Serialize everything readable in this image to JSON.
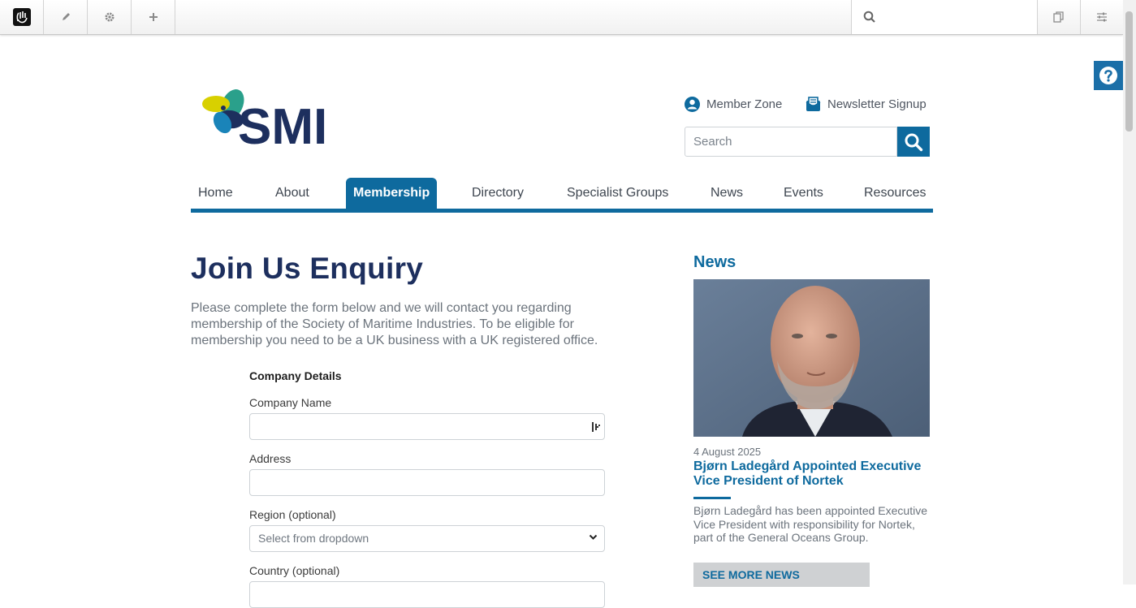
{
  "toolbar": {
    "icons": [
      "concrete-logo-icon",
      "pencil-icon",
      "gear-icon",
      "plus-icon",
      "search-icon",
      "pages-icon",
      "sliders-icon"
    ]
  },
  "header": {
    "logo_text": "SMI",
    "member_zone": "Member Zone",
    "newsletter": "Newsletter Signup",
    "search_placeholder": "Search"
  },
  "nav": {
    "items": [
      "Home",
      "About",
      "Membership",
      "Directory",
      "Specialist Groups",
      "News",
      "Events",
      "Resources"
    ],
    "active": "Membership"
  },
  "main": {
    "title": "Join Us Enquiry",
    "intro": "Please complete the form below and we will contact you regarding membership of the Society of Maritime Industries.  To be eligible for membership you need to be a UK business with a UK registered office.",
    "section": "Company Details",
    "fields": {
      "company_name": "Company Name",
      "address": "Address",
      "region": "Region (optional)",
      "region_placeholder": "Select from dropdown",
      "country": "Country (optional)"
    }
  },
  "sidebar": {
    "heading": "News",
    "date": "4 August 2025",
    "title": "Bjørn Ladegård Appointed Executive Vice President of Nortek",
    "summary": "Bjørn Ladegård has been appointed Executive Vice President with responsibility for Nortek, part of the General Oceans Group.",
    "more": "SEE MORE NEWS"
  },
  "colors": {
    "brand_blue": "#0e6a9e",
    "title_navy": "#1d2f5e",
    "logo_green": "#2aa08b",
    "logo_yellow": "#d8d000"
  }
}
